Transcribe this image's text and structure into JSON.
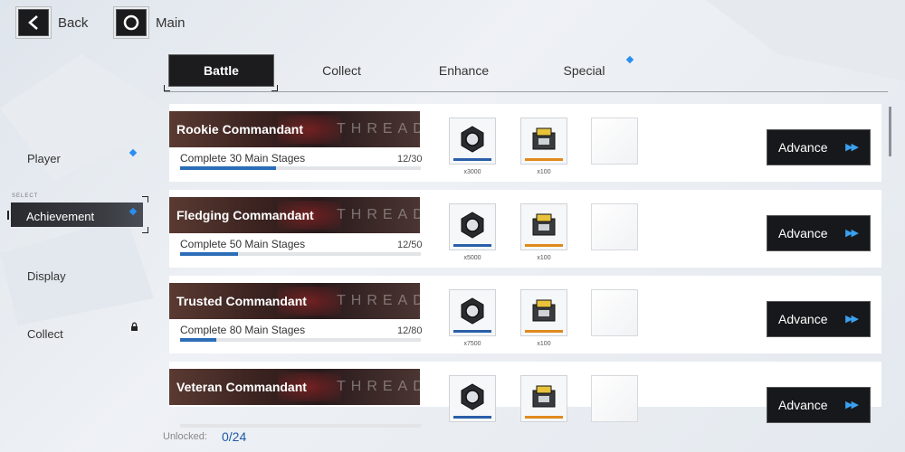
{
  "nav": {
    "back_label": "Back",
    "main_label": "Main"
  },
  "sidebar": {
    "select_tag": "SELECT",
    "items": [
      {
        "label": "Player",
        "notify": true
      },
      {
        "label": "Achievement",
        "active": true,
        "notify": true
      },
      {
        "label": "Display"
      },
      {
        "label": "Collect",
        "locked": true
      }
    ]
  },
  "tabs": [
    {
      "label": "Battle",
      "active": true
    },
    {
      "label": "Collect"
    },
    {
      "label": "Enhance"
    },
    {
      "label": "Special",
      "notify": true
    }
  ],
  "achievements": [
    {
      "title": "Rookie Commandant",
      "banner_text": "THREAD",
      "task": "Complete 30 Main Stages",
      "progress": "12/30",
      "progress_fraction": 0.4,
      "rewards": [
        {
          "icon": "hex-nut-icon",
          "qty": "x3000"
        },
        {
          "icon": "supply-chest-icon",
          "qty": "x100"
        }
      ],
      "button": "Advance"
    },
    {
      "title": "Fledging Commandant",
      "banner_text": "THREAD",
      "task": "Complete 50 Main Stages",
      "progress": "12/50",
      "progress_fraction": 0.24,
      "rewards": [
        {
          "icon": "hex-nut-icon",
          "qty": "x5000"
        },
        {
          "icon": "supply-chest-icon",
          "qty": "x100"
        }
      ],
      "button": "Advance"
    },
    {
      "title": "Trusted Commandant",
      "banner_text": "THREAD",
      "task": "Complete 80 Main Stages",
      "progress": "12/80",
      "progress_fraction": 0.15,
      "rewards": [
        {
          "icon": "hex-nut-icon",
          "qty": "x7500"
        },
        {
          "icon": "supply-chest-icon",
          "qty": "x100"
        }
      ],
      "button": "Advance"
    },
    {
      "title": "Veteran Commandant",
      "banner_text": "THREAD",
      "task": "",
      "progress": "",
      "progress_fraction": 0,
      "rewards": [
        {
          "icon": "hex-nut-icon",
          "qty": ""
        },
        {
          "icon": "supply-chest-icon",
          "qty": ""
        }
      ],
      "button": "Advance"
    }
  ],
  "footer": {
    "unlocked_label": "Unlocked:",
    "unlocked_value": "0/24"
  },
  "colors": {
    "accent_blue": "#2a8ff0",
    "progress_blue": "#2c6db7",
    "dark_button": "#17181b"
  }
}
